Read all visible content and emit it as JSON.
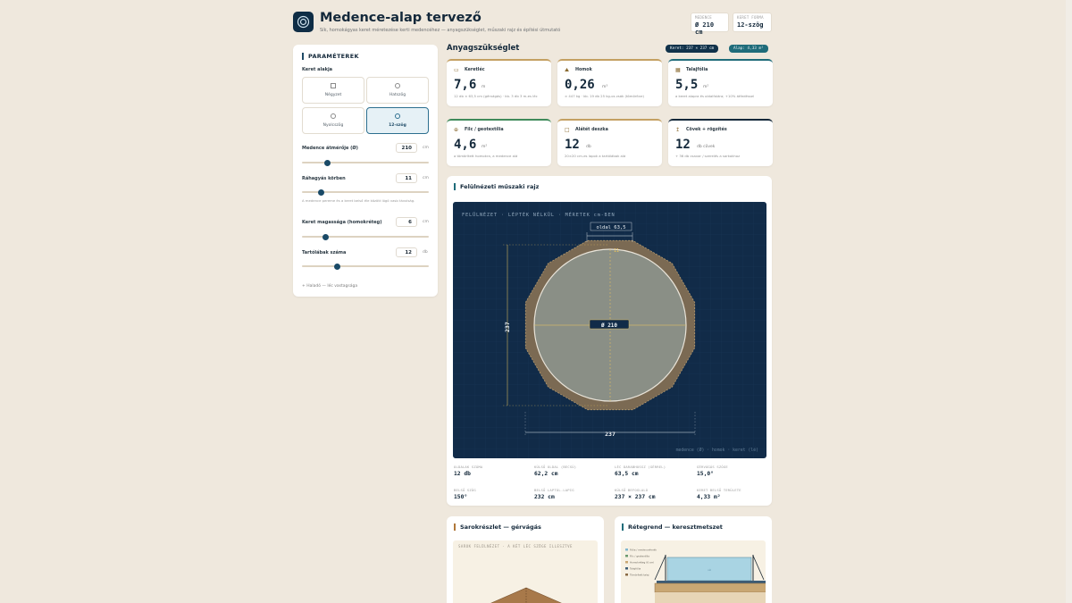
{
  "header": {
    "title": "Medence-alap tervező",
    "subtitle": "Sík, homokágyas keret méretezése kerti medencéhez — anyagszükséglet, műszaki rajz és építési útmutató",
    "stats": [
      {
        "label": "MEDENCE",
        "value": "Ø 210 cm"
      },
      {
        "label": "KERET FORMA",
        "value": "12-szög"
      }
    ]
  },
  "params": {
    "title": "PARAMÉTEREK",
    "shape_label": "Keret alakja",
    "shapes": [
      {
        "name": "Négyzet",
        "selected": false
      },
      {
        "name": "Hatszög",
        "selected": false
      },
      {
        "name": "Nyolcszög",
        "selected": false
      },
      {
        "name": "12-szög",
        "selected": true
      }
    ],
    "diameter": {
      "label": "Medence átmérője (Ø)",
      "value": "210",
      "unit": "cm",
      "level": 0.2
    },
    "overhang": {
      "label": "Ráhagyás körben",
      "value": "11",
      "unit": "cm",
      "hint": "A medence pereme és a keret belső éle között lógó vasb távolság.",
      "level": 0.15
    },
    "height": {
      "label": "Keret magassága (homokréteg)",
      "value": "6",
      "unit": "cm",
      "level": 0.19
    },
    "legs": {
      "label": "Tartólábak száma",
      "value": "12",
      "unit": "db",
      "level": 0.28
    },
    "advanced": "+ Haladó — léc vastagsága"
  },
  "materials": {
    "title": "Anyagszükséglet",
    "chips": [
      "Keret: 237 × 237 cm",
      "Alap: 4,33 m²"
    ],
    "cards": [
      {
        "icon": "▭",
        "title": "Keretléc",
        "value": "7,6",
        "unit": "m",
        "note": "12 db × 63,5 cm (gérvágás) · kb. 3 db 3 m-es léc",
        "color": "#c4a062"
      },
      {
        "icon": "⛰",
        "title": "Homok",
        "value": "0,26",
        "unit": "m³",
        "note": "≈ 447 kg · kb. 19 db 25 kg-os zsák (tömörítve)",
        "color": "#c4a062"
      },
      {
        "icon": "▦",
        "title": "Talajfólia",
        "value": "5,5",
        "unit": "m²",
        "note": "a keret alapra és oldalfalára; +10% átfedéssel",
        "color": "#1f6c7a"
      },
      {
        "icon": "⊕",
        "title": "Filc / geotextília",
        "value": "4,6",
        "unit": "m²",
        "note": "a tömörített homokra, a medence alá",
        "color": "#3f8a5a"
      },
      {
        "icon": "□",
        "title": "Alátét deszka",
        "value": "12",
        "unit": "db",
        "note": "20×20 cm-es lapok a tartólábak alá",
        "color": "#c4a062"
      },
      {
        "icon": "↥",
        "title": "Cövek + rögzítés",
        "value": "12",
        "unit": "db cövek",
        "note": "+ 36 db csavar / szerelés a sarkokhoz",
        "color": "#13283a"
      }
    ]
  },
  "drawing": {
    "title": "Felülnézeti műszaki rajz",
    "caption": "FELÜLNÉZET · LÉPTÉK NÉLKÜL · MÉRETEK cm-BEN",
    "side_label": "oldal 63,5",
    "overhang_label": "11",
    "diameter_label": "Ø 210",
    "width_label": "237",
    "height_label": "237",
    "legend": "medence (Ø)  · homok  · keret (lé)",
    "stats": [
      {
        "label": "OLDALAK SZÁMA",
        "value": "12 db"
      },
      {
        "label": "KÜLSŐ OLDAL (BECSÜ)",
        "value": "62,2 cm"
      },
      {
        "label": "LÉC DARABHOSSZ (GÉRREL)",
        "value": "63,5 cm"
      },
      {
        "label": "GÉRVÁGÁS SZÖGE",
        "value": "15,0°"
      },
      {
        "label": "BELSŐ SZÖG",
        "value": "150°"
      },
      {
        "label": "BELSŐ LAPTÓL-LAPIG",
        "value": "232 cm"
      },
      {
        "label": "KÜLSŐ BEFOGLALÓ",
        "value": "237 × 237 cm"
      },
      {
        "label": "KERET BELSŐ TERÜLETE",
        "value": "4,33 m²"
      }
    ]
  },
  "corner": {
    "title": "Sarokrészlet — gérvágás",
    "caption": "SAROK FELÜLNÉZET · A KÉT LÉC SZÖGE ILLESZTVE"
  },
  "layers": {
    "title": "Rétegrend — keresztmetszet",
    "legend": [
      "Fólia / medencefenék",
      "Filc / geotextília",
      "Homokréteg (6 cm)",
      "Talajfólia",
      "Tömörített talaj"
    ],
    "colors": [
      "#7fb7cf",
      "#6b9a6f",
      "#c9a773",
      "#3d5c75",
      "#8a6a45"
    ]
  },
  "colors": {
    "navy": "#112b48",
    "sand": "#7b6a53",
    "water": "#8a8f86",
    "accent": "#f0c75a"
  }
}
